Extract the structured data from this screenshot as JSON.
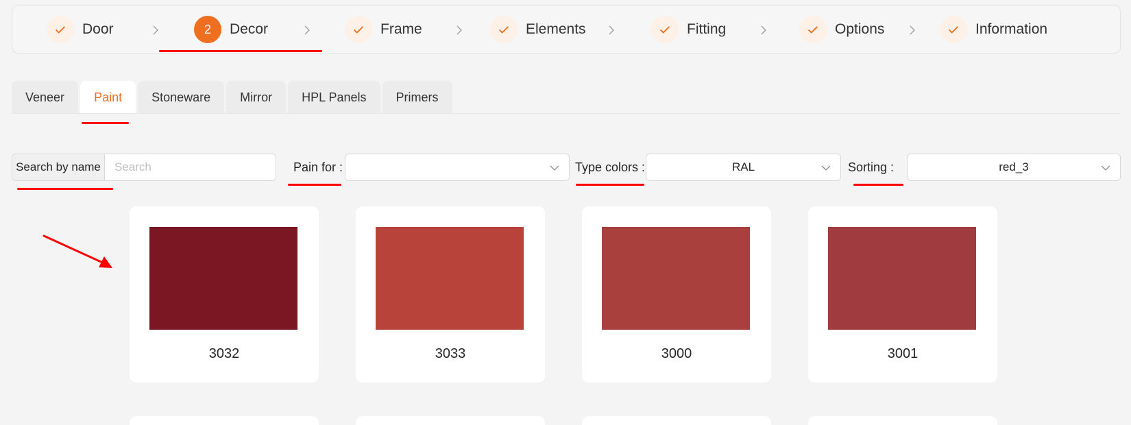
{
  "stepper": {
    "steps": [
      {
        "label": "Door",
        "state": "done",
        "icon": "check-icon"
      },
      {
        "label": "Decor",
        "state": "active",
        "number": "2"
      },
      {
        "label": "Frame",
        "state": "done",
        "icon": "check-icon"
      },
      {
        "label": "Elements",
        "state": "done",
        "icon": "check-icon"
      },
      {
        "label": "Fitting",
        "state": "done",
        "icon": "check-icon"
      },
      {
        "label": "Options",
        "state": "done",
        "icon": "check-icon"
      },
      {
        "label": "Information",
        "state": "done",
        "icon": "check-icon"
      }
    ]
  },
  "tabs": {
    "items": [
      "Veneer",
      "Paint",
      "Stoneware",
      "Mirror",
      "HPL Panels",
      "Primers"
    ],
    "active": "Paint"
  },
  "filters": {
    "search_label": "Search by name",
    "search_placeholder": "Search",
    "search_value": "",
    "paint_for_label": "Pain for",
    "paint_for_value": "",
    "type_colors_label": "Type colors",
    "type_colors_value": "RAL",
    "sorting_label": "Sorting",
    "sorting_value": "red_3"
  },
  "colors": {
    "accent": "#ee6f1f",
    "annotation": "#ff0000"
  },
  "cards": [
    {
      "code": "3032",
      "color": "#7b1623"
    },
    {
      "code": "3033",
      "color": "#b8433b"
    },
    {
      "code": "3000",
      "color": "#a9403e"
    },
    {
      "code": "3001",
      "color": "#a03b3f"
    }
  ]
}
